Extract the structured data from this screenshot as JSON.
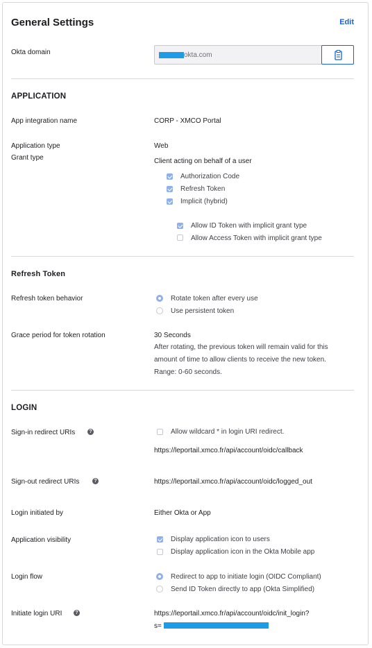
{
  "header": {
    "title": "General Settings",
    "edit_label": "Edit"
  },
  "okta_domain": {
    "label": "Okta domain",
    "value": "okta.com",
    "copy_icon": "clipboard-icon"
  },
  "application": {
    "heading": "APPLICATION",
    "integration_name_label": "App integration name",
    "integration_name_value": "CORP - XMCO Portal",
    "type_label": "Application type",
    "type_value": "Web",
    "grant_label": "Grant type",
    "grant_value": "Client acting on behalf of a user",
    "grant_options": [
      {
        "label": "Authorization Code",
        "checked": true
      },
      {
        "label": "Refresh Token",
        "checked": true
      },
      {
        "label": "Implicit (hybrid)",
        "checked": true
      }
    ],
    "implicit_options": [
      {
        "label": "Allow ID Token with implicit grant type",
        "checked": true
      },
      {
        "label": "Allow Access Token with implicit grant type",
        "checked": false
      }
    ]
  },
  "refresh": {
    "heading": "Refresh Token",
    "behavior_label": "Refresh token behavior",
    "behavior_options": [
      {
        "label": "Rotate token after every use",
        "selected": true
      },
      {
        "label": "Use persistent token",
        "selected": false
      }
    ],
    "grace_label": "Grace period for token rotation",
    "grace_value": "30 Seconds",
    "grace_help_1": "After rotating, the previous token will remain valid for this",
    "grace_help_2": "amount of time to allow clients to receive the new token.",
    "grace_help_3": "Range: 0-60 seconds."
  },
  "login": {
    "heading": "LOGIN",
    "signin_label": "Sign-in redirect URIs",
    "wildcard_label": "Allow wildcard * in login URI redirect.",
    "wildcard_checked": false,
    "signin_uri": "https://leportail.xmco.fr/api/account/oidc/callback",
    "signout_label": "Sign-out redirect URIs",
    "signout_uri": "https://leportail.xmco.fr/api/account/oidc/logged_out",
    "initiated_label": "Login initiated by",
    "initiated_value": "Either Okta or App",
    "visibility_label": "Application visibility",
    "visibility_options": [
      {
        "label": "Display application icon to users",
        "checked": true
      },
      {
        "label": "Display application icon in the Okta Mobile app",
        "checked": false
      }
    ],
    "flow_label": "Login flow",
    "flow_options": [
      {
        "label": "Redirect to app to initiate login (OIDC Compliant)",
        "selected": true
      },
      {
        "label": "Send ID Token directly to app (Okta Simplified)",
        "selected": false
      }
    ],
    "initiate_uri_label": "Initiate login URI",
    "initiate_uri_line1": "https://leportail.xmco.fr/api/account/oidc/init_login?",
    "initiate_uri_line2": "s="
  },
  "colors": {
    "accent": "#1662dd",
    "check": "#8fb0ea",
    "redaction": "#1d9be6",
    "border": "#d7d7dc"
  }
}
